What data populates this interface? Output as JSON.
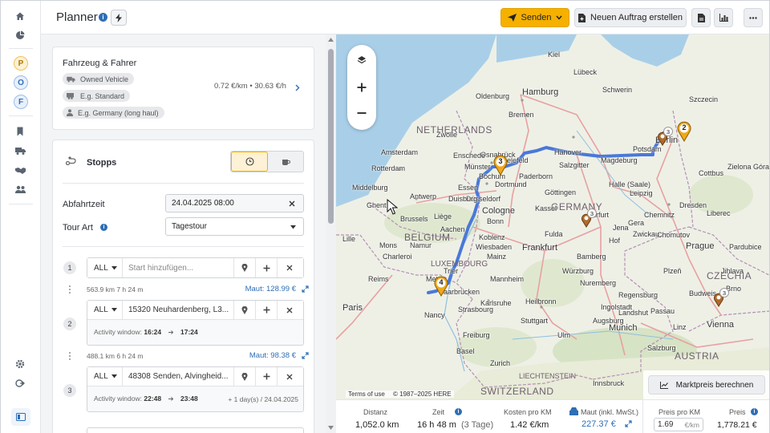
{
  "header": {
    "title": "Planner",
    "send_label": "Senden",
    "new_order_label": "Neuen Auftrag erstellen"
  },
  "rail": {
    "workspaces": [
      "P",
      "O",
      "F"
    ]
  },
  "vehicle": {
    "title": "Fahrzeug & Fahrer",
    "vehicle_tag": "Owned Vehicle",
    "standard_tag": "E.g. Standard",
    "driver_tag": "E.g. Germany (long haul)",
    "rate": "0.72 €/km • 30.63 €/h"
  },
  "stops": {
    "title": "Stopps",
    "departure_label": "Abfahrtzeit",
    "departure_value": "24.04.2025 08:00",
    "tour_type_label": "Tour Art",
    "tour_type_value": "Tagestour",
    "items": [
      {
        "num": "1",
        "filter": "ALL",
        "placeholder": "Start hinzufügen...",
        "address": "",
        "distance": "563.9 km   7 h 24 m",
        "maut": "Maut: 128.99 €"
      },
      {
        "num": "2",
        "filter": "ALL",
        "address": "15320 Neuhardenberg, L3...",
        "aw_label": "Activity window:",
        "aw_from": "16:24",
        "aw_to": "17:24",
        "distance": "488.1 km   6 h 24 m",
        "maut": "Maut: 98.38 €"
      },
      {
        "num": "3",
        "filter": "ALL",
        "address": "48308 Senden, Alvingheid...",
        "aw_label": "Activity window:",
        "aw_from": "22:48",
        "aw_to": "23:48",
        "aw_note": "+ 1 day(s) / 24.04.2025"
      }
    ]
  },
  "map": {
    "countries": [
      "NETHERLANDS",
      "BELGIUM",
      "LUXEMBOURG",
      "GERMANY",
      "CZECHIA",
      "AUSTRIA",
      "SWITZERLAND",
      "LIECHTENSTEIN"
    ],
    "cities": [
      "Hamburg",
      "Bremen",
      "Szczecin",
      "Amsterdam",
      "Rotterdam",
      "Antwerp",
      "Ghent",
      "Münster",
      "Bielefeld",
      "Dortmund",
      "Essen",
      "Düsseldorf",
      "Cologne",
      "Bonn",
      "Hanover",
      "Magdeburg",
      "Berlin",
      "Leipzig",
      "Dresden",
      "Chemnitz",
      "Prague",
      "Brno",
      "Vienna",
      "Munich",
      "Stuttgart",
      "Frankfurt",
      "Wiesbaden",
      "Mannheim",
      "Karlsruhe",
      "Strasbourg",
      "Saarbrücken",
      "Liège",
      "Charleroi",
      "Paris",
      "Reims",
      "Metz",
      "Nancy",
      "Würzburg",
      "Nuremberg",
      "Regensburg",
      "Erfurt",
      "Jena",
      "Kassel",
      "Göttingen",
      "Halle (Saale)",
      "Paderborn",
      "Osnabrück",
      "Zwolle",
      "Enschede",
      "Lille",
      "Brussels",
      "Middelburg",
      "Zielona Góra",
      "Kiel",
      "Lübeck",
      "Schwerin",
      "Oldenburg",
      "Salzgitter",
      "Potsdam",
      "Cottbus",
      "Linz",
      "Salzburg",
      "Innsbruck",
      "Zurich",
      "Basel",
      "Freiburg",
      "Ulm",
      "Augsburg",
      "Ingolstadt",
      "Plzeň",
      "Chomutov",
      "Liberec",
      "Pardubice",
      "Budweis",
      "Jihlava",
      "Passau",
      "Landshut",
      "Heilbronn",
      "Koblenz",
      "Trier",
      "Bochum",
      "Duisburg",
      "Aachen",
      "Mainz",
      "Fulda",
      "Bamberg",
      "Hof",
      "Gera",
      "Zwickau",
      "Mons",
      "Namur"
    ],
    "markers": [
      {
        "label": "2",
        "type": "stop"
      },
      {
        "label": "3",
        "type": "stop"
      },
      {
        "label": "4",
        "type": "stop"
      },
      {
        "label": "3",
        "type": "cluster"
      },
      {
        "label": "3",
        "type": "cluster"
      },
      {
        "label": "3",
        "type": "cluster"
      }
    ],
    "attribution_terms": "Terms of use",
    "attribution_copy": "© 1987–2025 HERE",
    "market_price_label": "Marktpreis berechnen",
    "route_color": "#4a78d9"
  },
  "summary": {
    "distance_label": "Distanz",
    "distance_value": "1,052.0 km",
    "time_label": "Zeit",
    "time_value": "16 h 48 m",
    "time_days": "(3 Tage)",
    "cost_label": "Kosten pro KM",
    "cost_value": "1.42 €/km",
    "toll_label": "Maut (inkl. MwSt.)",
    "toll_value": "227.37 €",
    "price_km_label": "Preis pro KM",
    "price_km_value": "1.69",
    "price_km_unit": "€/km",
    "price_label": "Preis",
    "price_value": "1,778.21 €"
  },
  "colors": {
    "accent": "#f5b000",
    "link": "#2e6eb5",
    "route": "#4a78d9",
    "marker": "#f0a81c"
  }
}
